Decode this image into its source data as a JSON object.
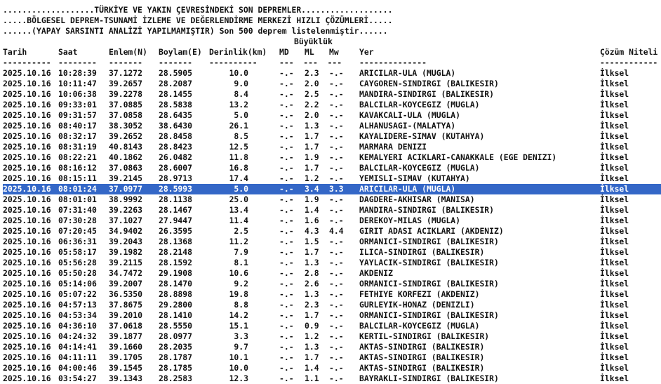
{
  "header": {
    "title_line": "...................TÜRKİYE VE YAKIN ÇEVRESİNDEKİ SON DEPREMLER...................",
    "subtitle_line": ".....BÖLGESEL DEPREM-TSUNAMİ İZLEME VE DEĞERLENDİRME MERKEZİ HIZLI ÇÖZÜMLERİ.....",
    "note_line": "......(YAPAY SARSINTI ANALİZİ YAPILMAMIŞTIR) Son 500 deprem listelenmiştir......",
    "magnitude_group": "Büyüklük"
  },
  "columns": {
    "date": "Tarih",
    "time": "Saat",
    "lat": "Enlem(N)",
    "lon": "Boylam(E)",
    "depth": "Derinlik(km)",
    "md": "MD",
    "ml": "ML",
    "mw": "Mw",
    "location": "Yer",
    "solution": "Çözüm Niteli"
  },
  "separators": {
    "date": "----------",
    "time": "--------",
    "lat": "-------",
    "lon": "-------",
    "depth": "----------",
    "mag": "---  ---  ---",
    "location": "--------------",
    "solution": "------------"
  },
  "rows": [
    {
      "date": "2025.10.16",
      "time": "10:28:39",
      "lat": "37.1272",
      "lon": "28.5905",
      "depth": "10.0",
      "md": "-.-",
      "ml": "2.3",
      "mw": "-.-",
      "loc": "ARICILAR-ULA (MUGLA)",
      "sol": "İlksel"
    },
    {
      "date": "2025.10.16",
      "time": "10:11:47",
      "lat": "39.2657",
      "lon": "28.2087",
      "depth": "9.0",
      "md": "-.-",
      "ml": "2.0",
      "mw": "-.-",
      "loc": "CAYGOREN-SINDIRGI (BALIKESIR)",
      "sol": "İlksel"
    },
    {
      "date": "2025.10.16",
      "time": "10:06:38",
      "lat": "39.2278",
      "lon": "28.1455",
      "depth": "8.4",
      "md": "-.-",
      "ml": "2.5",
      "mw": "-.-",
      "loc": "MANDIRA-SINDIRGI (BALIKESIR)",
      "sol": "İlksel"
    },
    {
      "date": "2025.10.16",
      "time": "09:33:01",
      "lat": "37.0885",
      "lon": "28.5838",
      "depth": "13.2",
      "md": "-.-",
      "ml": "2.2",
      "mw": "-.-",
      "loc": "BALCILAR-KOYCEGIZ (MUGLA)",
      "sol": "İlksel"
    },
    {
      "date": "2025.10.16",
      "time": "09:31:57",
      "lat": "37.0858",
      "lon": "28.6435",
      "depth": "5.0",
      "md": "-.-",
      "ml": "2.0",
      "mw": "-.-",
      "loc": "KAVAKCALI-ULA (MUGLA)",
      "sol": "İlksel"
    },
    {
      "date": "2025.10.16",
      "time": "08:40:17",
      "lat": "38.3052",
      "lon": "38.6430",
      "depth": "26.1",
      "md": "-.-",
      "ml": "1.3",
      "mw": "-.-",
      "loc": "ALHANUSAGI-(MALATYA)",
      "sol": "İlksel"
    },
    {
      "date": "2025.10.16",
      "time": "08:32:17",
      "lat": "39.2652",
      "lon": "28.8458",
      "depth": "8.5",
      "md": "-.-",
      "ml": "1.7",
      "mw": "-.-",
      "loc": "KAYALIDERE-SIMAV (KUTAHYA)",
      "sol": "İlksel"
    },
    {
      "date": "2025.10.16",
      "time": "08:31:19",
      "lat": "40.8143",
      "lon": "28.8423",
      "depth": "12.5",
      "md": "-.-",
      "ml": "1.7",
      "mw": "-.-",
      "loc": "MARMARA DENIZI",
      "sol": "İlksel"
    },
    {
      "date": "2025.10.16",
      "time": "08:22:21",
      "lat": "40.1862",
      "lon": "26.0482",
      "depth": "11.8",
      "md": "-.-",
      "ml": "1.9",
      "mw": "-.-",
      "loc": "KEMALYERI ACIKLARI-CANAKKALE (EGE DENIZI)",
      "sol": "İlksel"
    },
    {
      "date": "2025.10.16",
      "time": "08:16:12",
      "lat": "37.0863",
      "lon": "28.6007",
      "depth": "16.8",
      "md": "-.-",
      "ml": "1.7",
      "mw": "-.-",
      "loc": "BALCILAR-KOYCEGIZ (MUGLA)",
      "sol": "İlksel"
    },
    {
      "date": "2025.10.16",
      "time": "08:15:11",
      "lat": "39.2145",
      "lon": "28.9713",
      "depth": "17.4",
      "md": "-.-",
      "ml": "1.2",
      "mw": "-.-",
      "loc": "YEMISLI-SIMAV (KUTAHYA)",
      "sol": "İlksel"
    },
    {
      "date": "2025.10.16",
      "time": "08:01:24",
      "lat": "37.0977",
      "lon": "28.5993",
      "depth": "5.0",
      "md": "-.-",
      "ml": "3.4",
      "mw": "3.3",
      "loc": "ARICILAR-ULA (MUGLA)",
      "sol": "İlksel",
      "selected": true
    },
    {
      "date": "2025.10.16",
      "time": "08:01:01",
      "lat": "38.9992",
      "lon": "28.1138",
      "depth": "25.0",
      "md": "-.-",
      "ml": "1.9",
      "mw": "-.-",
      "loc": "DAGDERE-AKHISAR (MANISA)",
      "sol": "İlksel"
    },
    {
      "date": "2025.10.16",
      "time": "07:31:40",
      "lat": "39.2263",
      "lon": "28.1467",
      "depth": "13.4",
      "md": "-.-",
      "ml": "1.4",
      "mw": "-.-",
      "loc": "MANDIRA-SINDIRGI (BALIKESIR)",
      "sol": "İlksel"
    },
    {
      "date": "2025.10.16",
      "time": "07:30:28",
      "lat": "37.1027",
      "lon": "27.9447",
      "depth": "11.4",
      "md": "-.-",
      "ml": "1.6",
      "mw": "-.-",
      "loc": "DEREKOY-MILAS (MUGLA)",
      "sol": "İlksel"
    },
    {
      "date": "2025.10.16",
      "time": "07:20:45",
      "lat": "34.9402",
      "lon": "26.3595",
      "depth": "2.5",
      "md": "-.-",
      "ml": "4.3",
      "mw": "4.4",
      "loc": "GIRIT ADASI ACIKLARI (AKDENIZ)",
      "sol": "İlksel"
    },
    {
      "date": "2025.10.16",
      "time": "06:36:31",
      "lat": "39.2043",
      "lon": "28.1368",
      "depth": "11.2",
      "md": "-.-",
      "ml": "1.5",
      "mw": "-.-",
      "loc": "ORMANICI-SINDIRGI (BALIKESIR)",
      "sol": "İlksel"
    },
    {
      "date": "2025.10.16",
      "time": "05:58:17",
      "lat": "39.1982",
      "lon": "28.2148",
      "depth": "7.9",
      "md": "-.-",
      "ml": "1.7",
      "mw": "-.-",
      "loc": "ILICA-SINDIRGI (BALIKESIR)",
      "sol": "İlksel"
    },
    {
      "date": "2025.10.16",
      "time": "05:56:28",
      "lat": "39.2115",
      "lon": "28.1592",
      "depth": "8.1",
      "md": "-.-",
      "ml": "1.3",
      "mw": "-.-",
      "loc": "YAYLACIK-SINDIRGI (BALIKESIR)",
      "sol": "İlksel"
    },
    {
      "date": "2025.10.16",
      "time": "05:50:28",
      "lat": "34.7472",
      "lon": "29.1908",
      "depth": "10.6",
      "md": "-.-",
      "ml": "2.8",
      "mw": "-.-",
      "loc": "AKDENIZ",
      "sol": "İlksel"
    },
    {
      "date": "2025.10.16",
      "time": "05:14:06",
      "lat": "39.2007",
      "lon": "28.1470",
      "depth": "9.2",
      "md": "-.-",
      "ml": "2.6",
      "mw": "-.-",
      "loc": "ORMANICI-SINDIRGI (BALIKESIR)",
      "sol": "İlksel"
    },
    {
      "date": "2025.10.16",
      "time": "05:07:22",
      "lat": "36.5350",
      "lon": "28.8898",
      "depth": "19.8",
      "md": "-.-",
      "ml": "1.3",
      "mw": "-.-",
      "loc": "FETHIYE KORFEZI (AKDENIZ)",
      "sol": "İlksel"
    },
    {
      "date": "2025.10.16",
      "time": "04:57:13",
      "lat": "37.8675",
      "lon": "29.2800",
      "depth": "8.8",
      "md": "-.-",
      "ml": "2.3",
      "mw": "-.-",
      "loc": "GURLEYIK-HONAZ (DENIZLI)",
      "sol": "İlksel"
    },
    {
      "date": "2025.10.16",
      "time": "04:53:34",
      "lat": "39.2010",
      "lon": "28.1410",
      "depth": "14.2",
      "md": "-.-",
      "ml": "1.7",
      "mw": "-.-",
      "loc": "ORMANICI-SINDIRGI (BALIKESIR)",
      "sol": "İlksel"
    },
    {
      "date": "2025.10.16",
      "time": "04:36:10",
      "lat": "37.0618",
      "lon": "28.5550",
      "depth": "15.1",
      "md": "-.-",
      "ml": "0.9",
      "mw": "-.-",
      "loc": "BALCILAR-KOYCEGIZ (MUGLA)",
      "sol": "İlksel"
    },
    {
      "date": "2025.10.16",
      "time": "04:24:32",
      "lat": "39.1877",
      "lon": "28.0977",
      "depth": "3.3",
      "md": "-.-",
      "ml": "1.2",
      "mw": "-.-",
      "loc": "KERTIL-SINDIRGI (BALIKESIR)",
      "sol": "İlksel"
    },
    {
      "date": "2025.10.16",
      "time": "04:14:41",
      "lat": "39.1660",
      "lon": "28.2035",
      "depth": "9.7",
      "md": "-.-",
      "ml": "1.3",
      "mw": "-.-",
      "loc": "AKTAS-SINDIRGI (BALIKESIR)",
      "sol": "İlksel"
    },
    {
      "date": "2025.10.16",
      "time": "04:11:11",
      "lat": "39.1705",
      "lon": "28.1787",
      "depth": "10.1",
      "md": "-.-",
      "ml": "1.7",
      "mw": "-.-",
      "loc": "AKTAS-SINDIRGI (BALIKESIR)",
      "sol": "İlksel"
    },
    {
      "date": "2025.10.16",
      "time": "04:00:46",
      "lat": "39.1545",
      "lon": "28.1785",
      "depth": "10.0",
      "md": "-.-",
      "ml": "1.4",
      "mw": "-.-",
      "loc": "AKTAS-SINDIRGI (BALIKESIR)",
      "sol": "İlksel"
    },
    {
      "date": "2025.10.16",
      "time": "03:54:27",
      "lat": "39.1343",
      "lon": "28.2583",
      "depth": "12.3",
      "md": "-.-",
      "ml": "1.1",
      "mw": "-.-",
      "loc": "BAYRAKLI-SINDIRGI (BALIKESIR)",
      "sol": "İlksel"
    }
  ]
}
